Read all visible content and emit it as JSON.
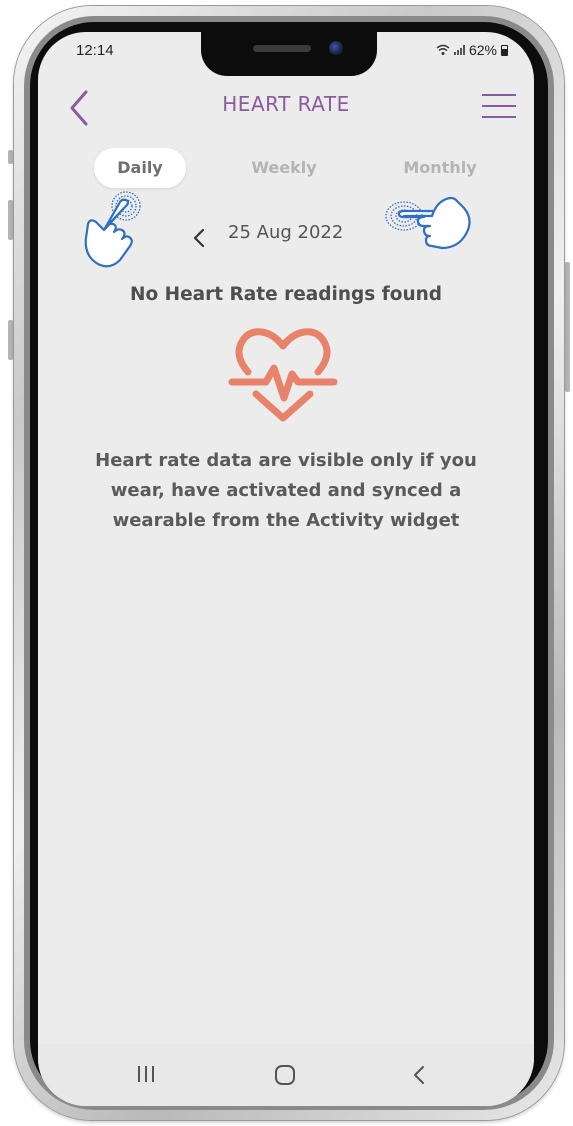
{
  "status": {
    "time": "12:14",
    "battery": "62%"
  },
  "header": {
    "title": "HEART RATE",
    "back_icon": "chevron-left-icon",
    "menu_icon": "hamburger-menu-icon"
  },
  "tabs": [
    {
      "label": "Daily",
      "active": true
    },
    {
      "label": "Weekly",
      "active": false
    },
    {
      "label": "Monthly",
      "active": false
    }
  ],
  "date_nav": {
    "prev_icon": "chevron-left-icon",
    "date": "25 Aug 2022"
  },
  "empty_state": {
    "title": "No Heart Rate readings found",
    "icon": "heart-pulse-icon",
    "message": "Heart rate data are visible only if you wear, have activated and synced a wearable from the Activity widget"
  },
  "colors": {
    "accent": "#8a5a9e",
    "heart": "#e8826a",
    "hand": "#2f6fc4",
    "screen_bg": "#ececec"
  }
}
